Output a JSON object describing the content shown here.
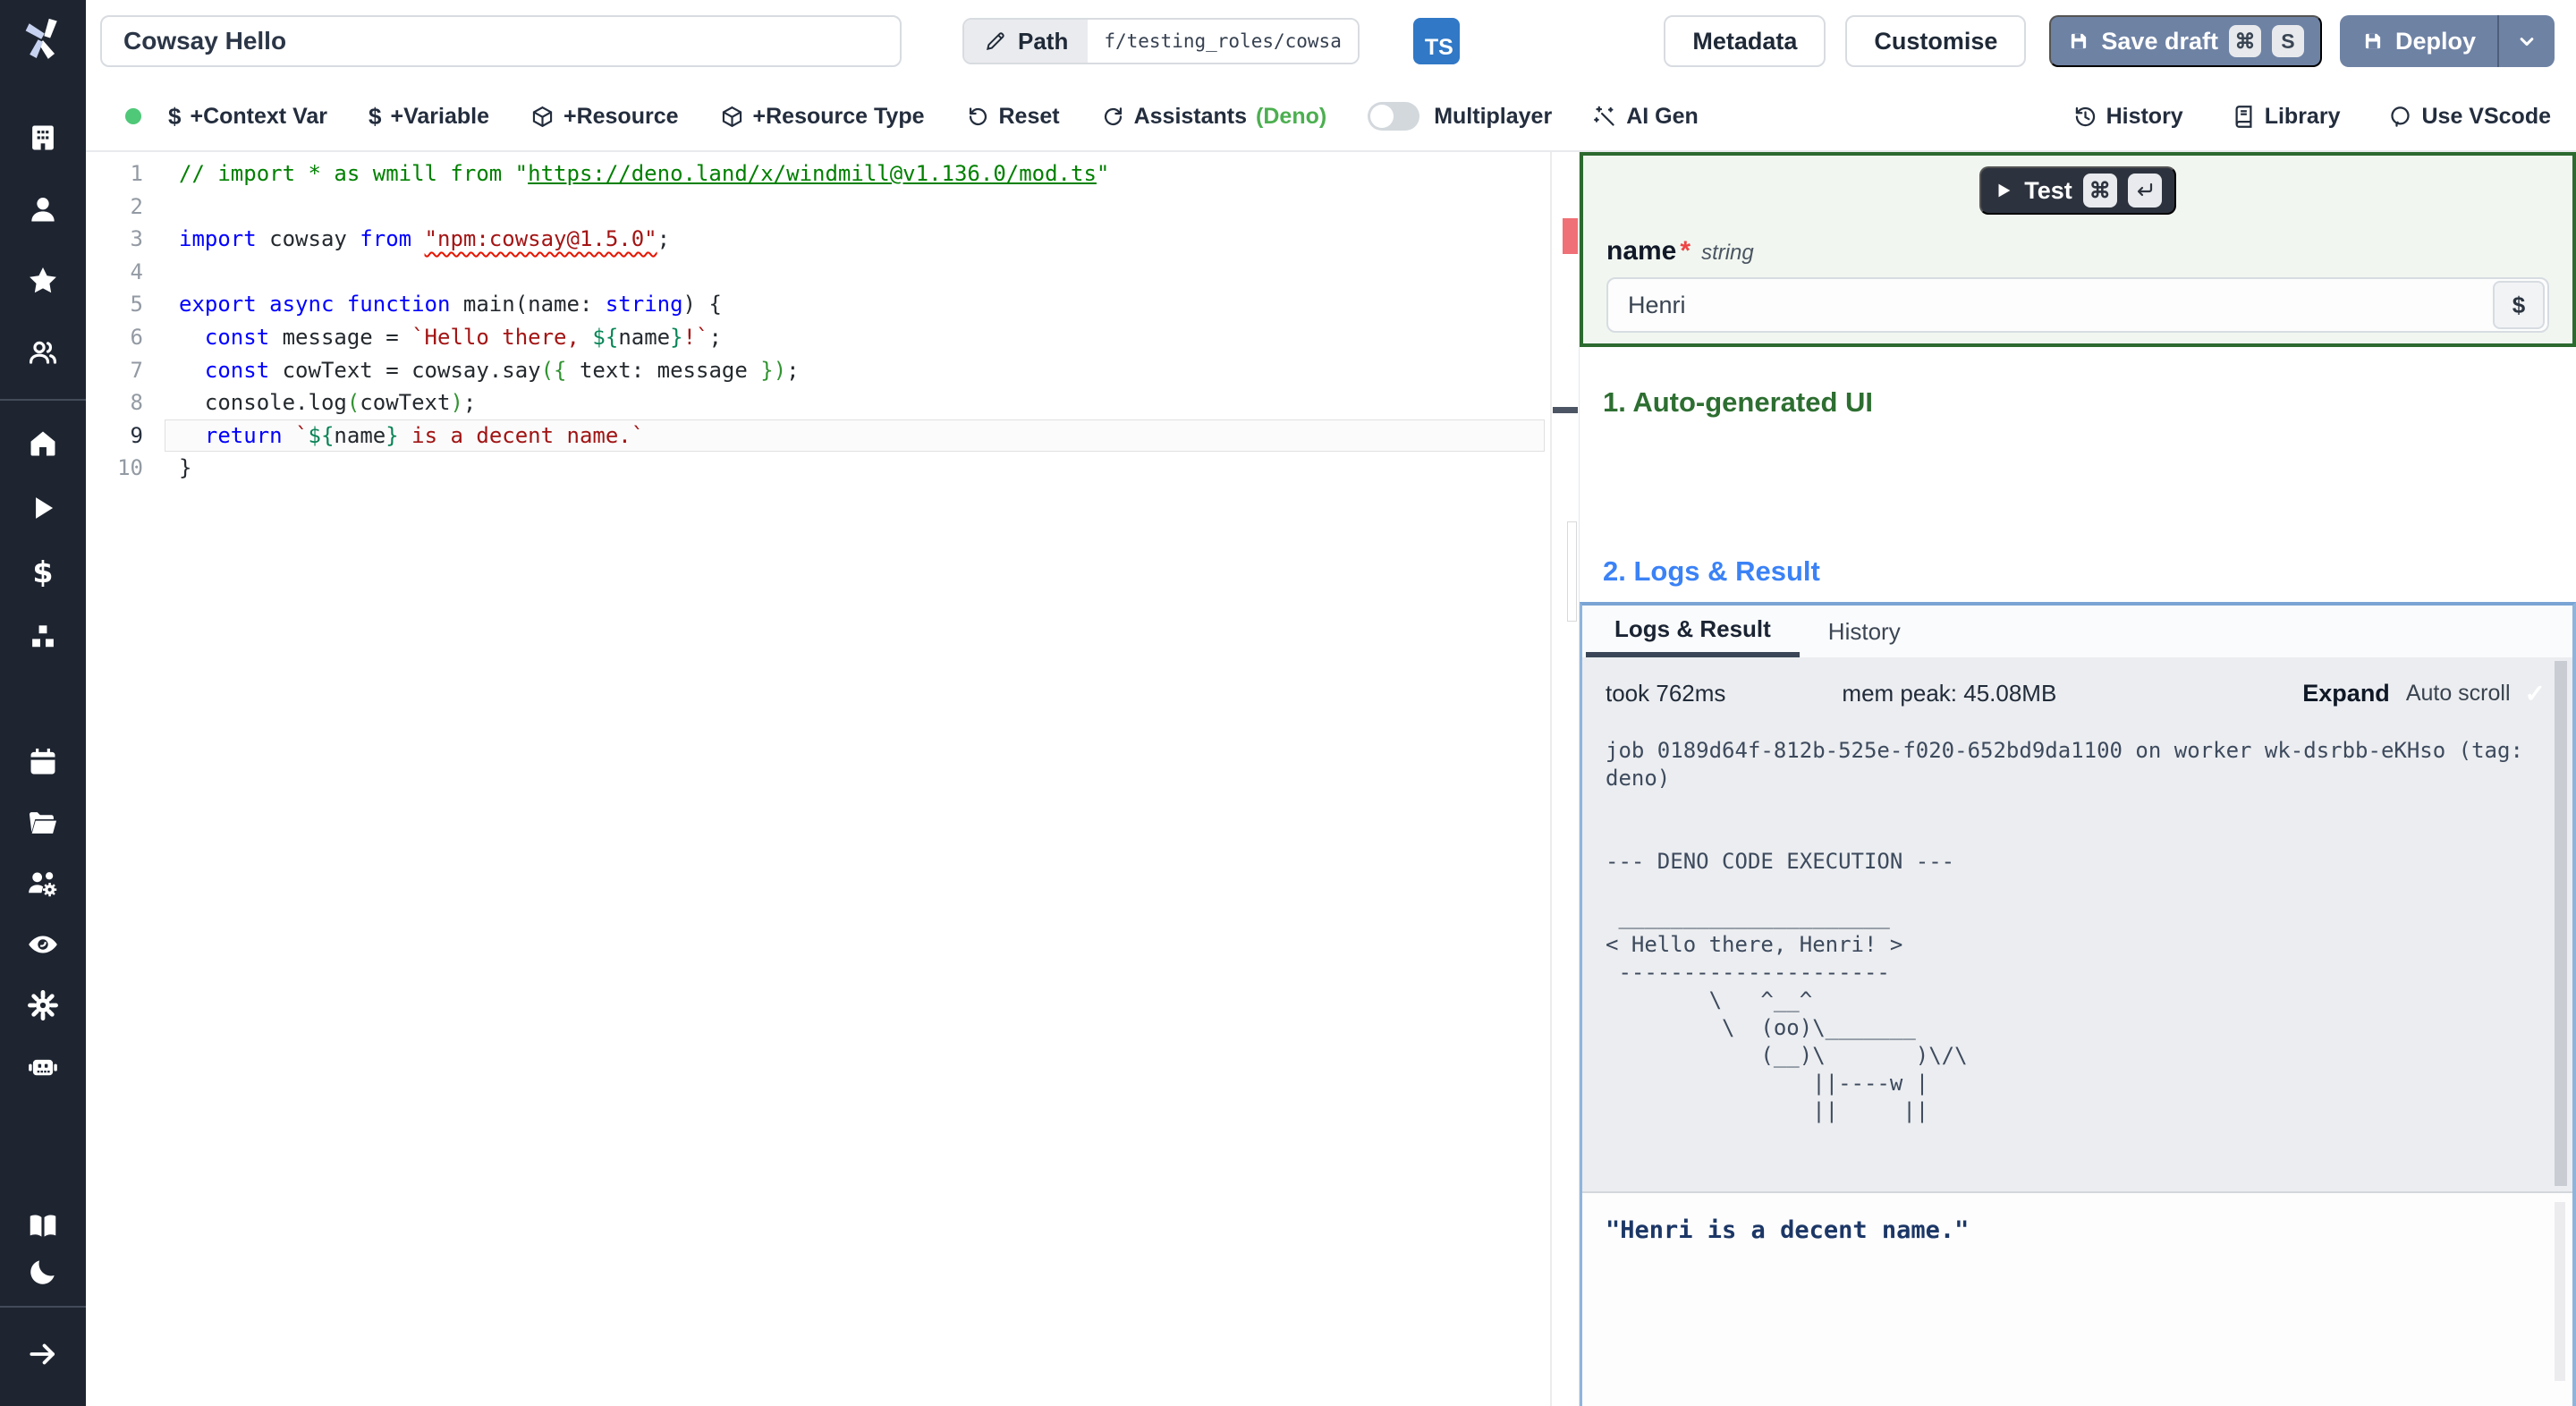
{
  "app": {
    "sidebar_bg": "#1e2531",
    "accent_green": "#2d6e31",
    "accent_blue": "#3b82f6",
    "slate_button": "#6e82a4",
    "ts_blue": "#3178c6",
    "deno_green": "#4caf50"
  },
  "topbar": {
    "title_value": "Cowsay Hello",
    "path_label": "Path",
    "path_value": "f/testing_roles/cowsa",
    "lang_badge": "TS",
    "metadata_label": "Metadata",
    "customise_label": "Customise",
    "save_draft_label": "Save draft",
    "save_keys": [
      "⌘",
      "S"
    ],
    "deploy_label": "Deploy"
  },
  "toolbar": {
    "dollar": "$",
    "context_var": "+Context Var",
    "variable": "+Variable",
    "resource": "+Resource",
    "resource_type": "+Resource Type",
    "reset": "Reset",
    "assistants": "Assistants",
    "assistants_lang": "(Deno)",
    "multiplayer": "Multiplayer",
    "ai_gen": "AI Gen",
    "history": "History",
    "library": "Library",
    "vscode": "Use VScode"
  },
  "editor": {
    "active_line": 9,
    "lines": [
      [
        [
          "cmt",
          "// import * as wmill from \""
        ],
        [
          "cmtlink",
          "https://deno.land/x/windmill@v1.136.0/mod.ts"
        ],
        [
          "cmt",
          "\""
        ]
      ],
      [],
      [
        [
          "kw",
          "import"
        ],
        [
          "pl",
          " cowsay "
        ],
        [
          "kw",
          "from"
        ],
        [
          "pl",
          " "
        ],
        [
          "strerr",
          "\"npm:cowsay@1.5.0\""
        ],
        [
          "pl",
          ";"
        ]
      ],
      [],
      [
        [
          "kw",
          "export"
        ],
        [
          "pl",
          " "
        ],
        [
          "kw",
          "async"
        ],
        [
          "pl",
          " "
        ],
        [
          "kw",
          "function"
        ],
        [
          "pl",
          " main(name: "
        ],
        [
          "kw",
          "string"
        ],
        [
          "pl",
          ") {"
        ]
      ],
      [
        [
          "pl",
          "  "
        ],
        [
          "kw",
          "const"
        ],
        [
          "pl",
          " message = "
        ],
        [
          "str",
          "`Hello there, "
        ],
        [
          "tpl",
          "${"
        ],
        [
          "pl",
          "name"
        ],
        [
          "tpl",
          "}"
        ],
        [
          "str",
          "!`"
        ],
        [
          "pl",
          ";"
        ]
      ],
      [
        [
          "pl",
          "  "
        ],
        [
          "kw",
          "const"
        ],
        [
          "pl",
          " cowText = cowsay.say"
        ],
        [
          "brk",
          "({"
        ],
        [
          "pl",
          " text: message "
        ],
        [
          "brk",
          "})"
        ],
        [
          "pl",
          ";"
        ]
      ],
      [
        [
          "pl",
          "  console.log"
        ],
        [
          "brk",
          "("
        ],
        [
          "pl",
          "cowText"
        ],
        [
          "brk",
          ")"
        ],
        [
          "pl",
          ";"
        ]
      ],
      [
        [
          "pl",
          "  "
        ],
        [
          "kw",
          "return"
        ],
        [
          "pl",
          " "
        ],
        [
          "str",
          "`"
        ],
        [
          "tpl",
          "${"
        ],
        [
          "pl",
          "name"
        ],
        [
          "tpl",
          "}"
        ],
        [
          "str",
          " is a decent name.`"
        ]
      ],
      [
        [
          "pl",
          "}"
        ]
      ]
    ]
  },
  "panel": {
    "test_label": "Test",
    "test_key_cmd": "⌘",
    "field_name": "name",
    "field_required": "*",
    "field_type": "string",
    "field_value": "Henri",
    "dollar_button": "$",
    "section1": "1. Auto-generated UI",
    "section2": "2. Logs & Result",
    "tab_logs": "Logs & Result",
    "tab_history": "History",
    "took": "took 762ms",
    "mem": "mem peak: 45.08MB",
    "expand": "Expand",
    "autoscroll": "Auto scroll",
    "check": "✓",
    "log_text": "job 0189d64f-812b-525e-f020-652bd9da1100 on worker wk-dsrbb-eKHso (tag:\ndeno)\n\n\n--- DENO CODE EXECUTION ---\n\n _____________________\n< Hello there, Henri! >\n ---------------------\n        \\   ^__^\n         \\  (oo)\\_______\n            (__)\\       )\\/\\\n                ||----w |\n                ||     ||",
    "result_text": "\"Henri is a decent name.\""
  }
}
